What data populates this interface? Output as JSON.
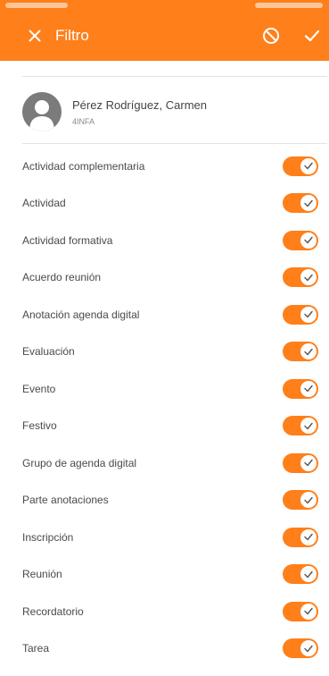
{
  "colors": {
    "accent": "#ff7f1a",
    "toggle_on": "#ff7f1a",
    "avatar_bg": "#7b7b7b"
  },
  "header": {
    "title": "Filtro",
    "close_icon": "close-icon",
    "clear_icon": "block-icon",
    "apply_icon": "check-icon"
  },
  "user": {
    "name": "Pérez Rodríguez, Carmen",
    "group": "4INFA",
    "avatar_icon": "person-icon"
  },
  "filters": [
    {
      "label": "Actividad complementaria",
      "enabled": true
    },
    {
      "label": "Actividad",
      "enabled": true
    },
    {
      "label": "Actividad formativa",
      "enabled": true
    },
    {
      "label": "Acuerdo reunión",
      "enabled": true
    },
    {
      "label": "Anotación agenda digital",
      "enabled": true
    },
    {
      "label": "Evaluación",
      "enabled": true
    },
    {
      "label": "Evento",
      "enabled": true
    },
    {
      "label": "Festivo",
      "enabled": true
    },
    {
      "label": "Grupo de agenda digital",
      "enabled": true
    },
    {
      "label": "Parte anotaciones",
      "enabled": true
    },
    {
      "label": "Inscripción",
      "enabled": true
    },
    {
      "label": "Reunión",
      "enabled": true
    },
    {
      "label": "Recordatorio",
      "enabled": true
    },
    {
      "label": "Tarea",
      "enabled": true
    }
  ]
}
